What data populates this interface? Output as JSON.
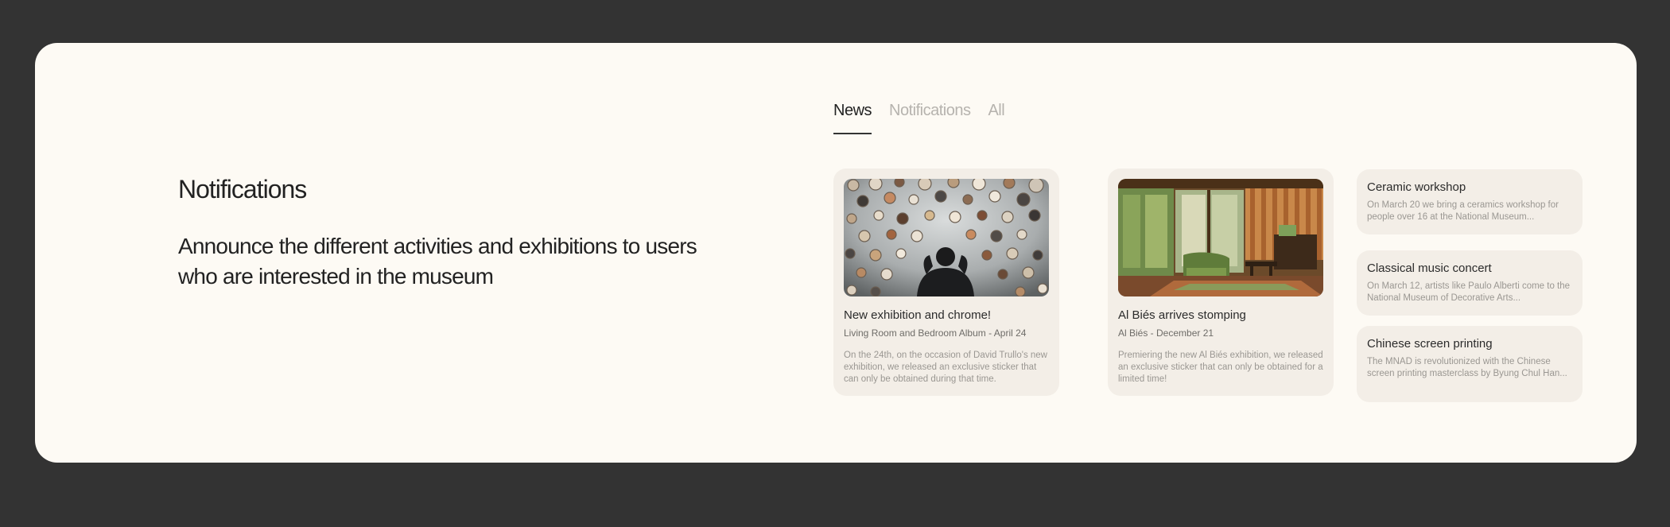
{
  "intro": {
    "title": "Notifications",
    "description": "Announce the different activities and exhibitions to users who are interested in the museum"
  },
  "tabs": [
    {
      "label": "News",
      "active": true
    },
    {
      "label": "Notifications",
      "active": false
    },
    {
      "label": "All",
      "active": false
    }
  ],
  "featured": [
    {
      "title": "New exhibition and chrome!",
      "subtitle": "Living Room and Bedroom Album - April 24",
      "body": "On the 24th, on the occasion of David Trullo's new exhibition, we released an exclusive sticker that can only be obtained during that time."
    },
    {
      "title": "Al Biés arrives stomping",
      "subtitle": "Al Biés - December 21",
      "body": "Premiering the new Al Biés exhibition, we released an exclusive sticker that can only be obtained for a limited time!"
    }
  ],
  "list": [
    {
      "title": "Ceramic workshop",
      "body": "On March 20 we bring a ceramics workshop for people over 16 at the National Museum..."
    },
    {
      "title": "Classical music concert",
      "body": "On March 12, artists like Paulo Alberti come to the National Museum of Decorative Arts..."
    },
    {
      "title": "Chinese screen printing",
      "body": "The MNAD is revolutionized with the Chinese screen printing masterclass by Byung Chul Han..."
    }
  ],
  "colors": {
    "background": "#333333",
    "panel": "#fdfaf4",
    "card": "#f3eee7",
    "text": "#222222",
    "muted": "#9a9792"
  }
}
